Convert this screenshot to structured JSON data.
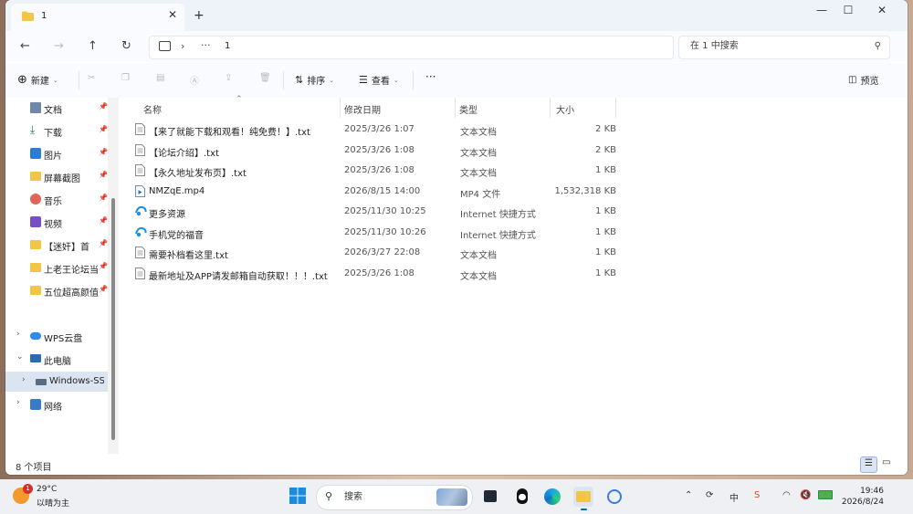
{
  "tab": {
    "title": "1",
    "close": "✕",
    "new": "+"
  },
  "window_controls": {
    "minimize": "—",
    "maximize": "☐",
    "close": "✕"
  },
  "nav": {
    "back": "←",
    "forward": "→",
    "up": "↑",
    "refresh": "↻"
  },
  "address": {
    "separator": "›",
    "more": "···",
    "crumb": "1"
  },
  "search": {
    "placeholder": "在 1 中搜索"
  },
  "toolbar": {
    "new_label": "新建",
    "sort_label": "排序",
    "view_label": "查看",
    "more": "···",
    "preview_label": "预览"
  },
  "sidebar": {
    "quick": [
      {
        "label": "文档",
        "icon": "document-icon"
      },
      {
        "label": "下载",
        "icon": "download-icon"
      },
      {
        "label": "图片",
        "icon": "picture-icon"
      },
      {
        "label": "屏幕截图",
        "icon": "folder-icon"
      },
      {
        "label": "音乐",
        "icon": "music-icon"
      },
      {
        "label": "视频",
        "icon": "video-icon"
      },
      {
        "label": "【迷奸】首",
        "icon": "folder-icon"
      },
      {
        "label": "上老王论坛当",
        "icon": "folder-icon"
      },
      {
        "label": "五位超高颜值",
        "icon": "folder-icon"
      }
    ],
    "wps": "WPS云盘",
    "thispc": "此电脑",
    "drive": "Windows-SSD",
    "network": "网络"
  },
  "columns": {
    "name": "名称",
    "modified": "修改日期",
    "type": "类型",
    "size": "大小"
  },
  "files": [
    {
      "name": "【来了就能下载和观看！纯免费！】.txt",
      "modified": "2025/3/26 1:07",
      "type": "文本文档",
      "size": "2 KB",
      "icon": "text-file-icon"
    },
    {
      "name": "【论坛介绍】.txt",
      "modified": "2025/3/26 1:08",
      "type": "文本文档",
      "size": "2 KB",
      "icon": "text-file-icon"
    },
    {
      "name": "【永久地址发布页】.txt",
      "modified": "2025/3/26 1:08",
      "type": "文本文档",
      "size": "1 KB",
      "icon": "text-file-icon"
    },
    {
      "name": "NMZqE.mp4",
      "modified": "2026/8/15 14:00",
      "type": "MP4 文件",
      "size": "1,532,318 KB",
      "icon": "video-file-icon"
    },
    {
      "name": "更多资源",
      "modified": "2025/11/30 10:25",
      "type": "Internet 快捷方式",
      "size": "1 KB",
      "icon": "internet-shortcut-icon"
    },
    {
      "name": "手机党的福音",
      "modified": "2025/11/30 10:26",
      "type": "Internet 快捷方式",
      "size": "1 KB",
      "icon": "internet-shortcut-icon"
    },
    {
      "name": "需要补档看这里.txt",
      "modified": "2026/3/27 22:08",
      "type": "文本文档",
      "size": "1 KB",
      "icon": "text-file-icon"
    },
    {
      "name": "最新地址及APP请发邮箱自动获取！！！.txt",
      "modified": "2025/3/26 1:08",
      "type": "文本文档",
      "size": "1 KB",
      "icon": "text-file-icon"
    }
  ],
  "status": {
    "count": "8 个项目"
  },
  "taskbar": {
    "weather_badge": "1",
    "temp": "29°C",
    "condition": "以晴为主",
    "search_placeholder": "搜索",
    "ime": "中",
    "time": "19:46",
    "date": "2026/8/24"
  },
  "colors": {
    "accent": "#0067c0",
    "folder": "#f3c546",
    "selected": "#dbe4f1"
  }
}
